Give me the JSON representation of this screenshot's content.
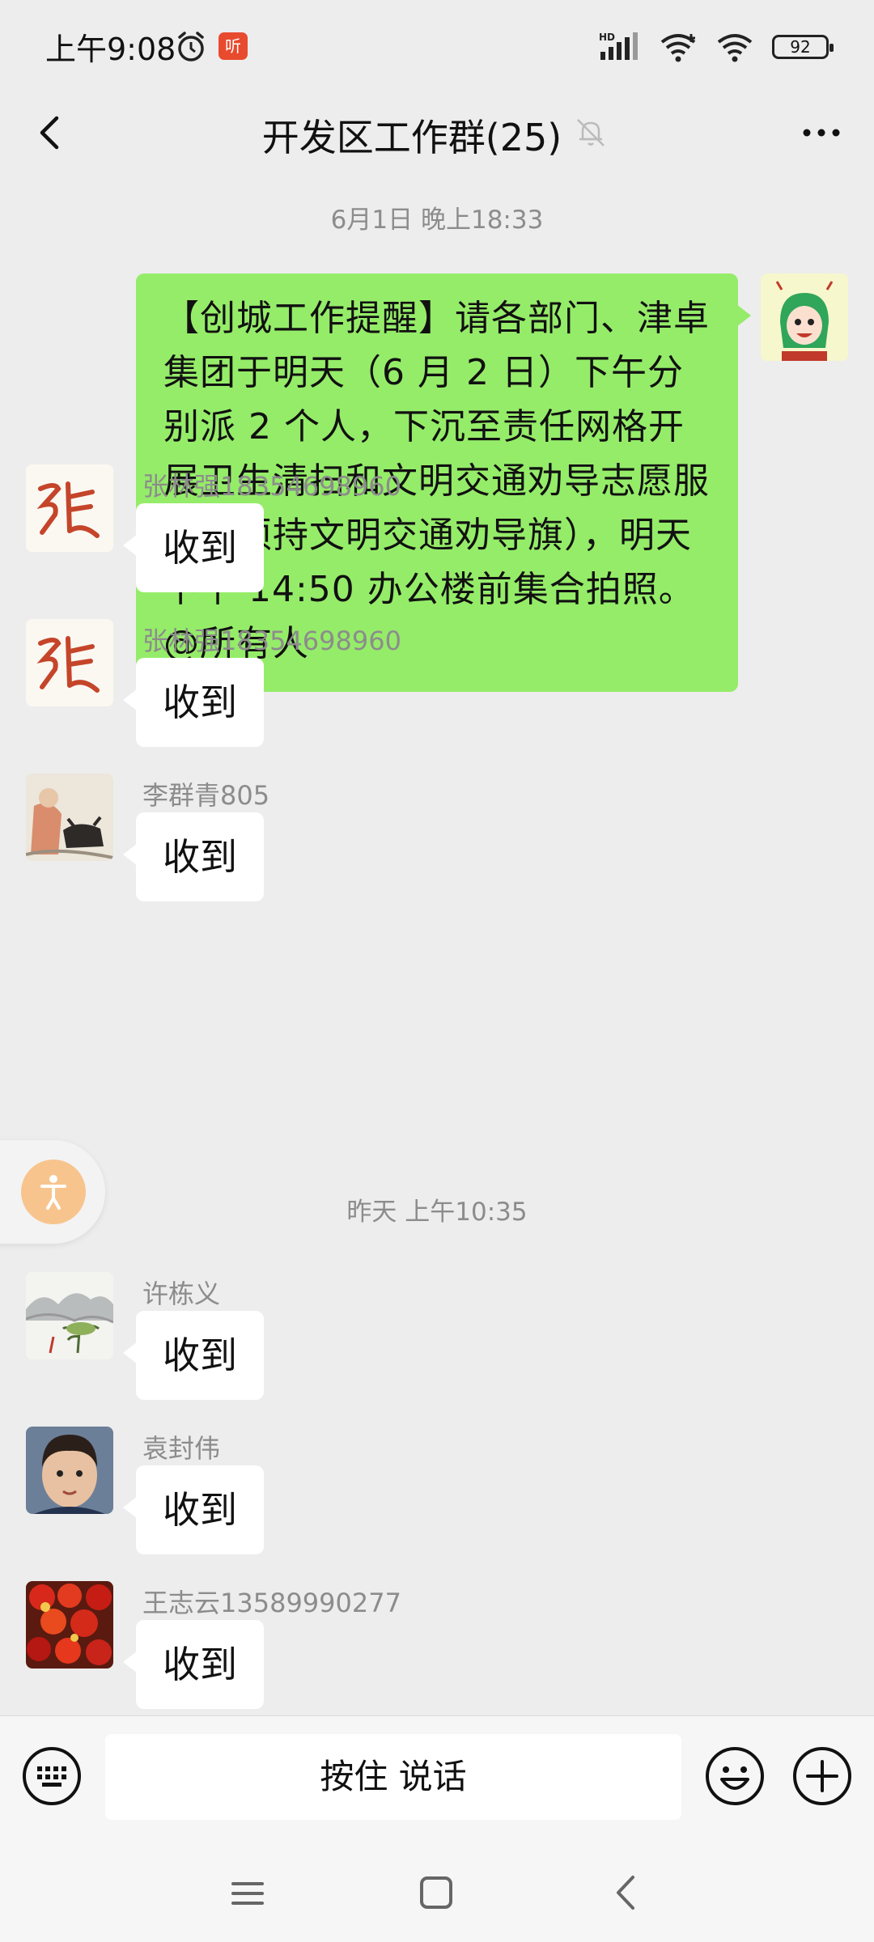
{
  "status_bar": {
    "time": "上午9:08",
    "app_badge": "听",
    "network_label": "HD",
    "battery": "92"
  },
  "header": {
    "title": "开发区工作群(25)"
  },
  "messages": {
    "timestamp_1": "6月1日 晚上18:33",
    "sent_text": "【创城工作提醒】请各部门、津卓集团于明天（6 月 2 日）下午分别派 2 个人，下沉至责任网格开展卫生清扫和文明交通劝导志愿服务（须持文明交通劝导旗），明天下午 14:50 办公楼前集合拍照。@所有人",
    "timestamp_2": "昨天 上午10:35",
    "received": [
      {
        "sender": "张林强18354698960",
        "text": "收到"
      },
      {
        "sender": "张林强18354698960",
        "text": "收到"
      },
      {
        "sender": "李群青805",
        "text": "收到"
      },
      {
        "sender": "许栋义",
        "text": "收到"
      },
      {
        "sender": "袁封伟",
        "text": "收到"
      },
      {
        "sender": "王志云13589990277",
        "text": "收到"
      }
    ]
  },
  "input_bar": {
    "voice_label": "按住 说话"
  },
  "colors": {
    "background": "#ededed",
    "sent_bubble": "#95ec69",
    "received_bubble": "#ffffff",
    "meta_text": "#8c8c8c"
  },
  "icons": [
    "alarm-icon",
    "signal-icon",
    "wifi-icon",
    "battery-icon",
    "back-icon",
    "mute-icon",
    "more-icon",
    "keyboard-icon",
    "emoji-icon",
    "plus-icon",
    "nav-menu-icon",
    "nav-home-icon",
    "nav-back-icon"
  ]
}
